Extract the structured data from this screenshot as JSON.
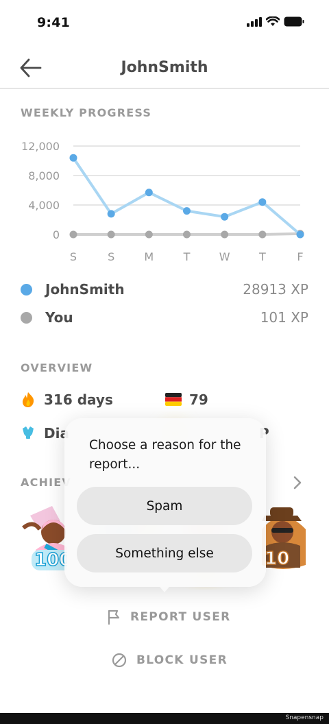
{
  "status": {
    "time": "9:41"
  },
  "header": {
    "title": "JohnSmith"
  },
  "weekly": {
    "section_title": "WEEKLY PROGRESS",
    "legend": [
      {
        "name": "JohnSmith",
        "xp": "28913 XP",
        "color": "#5aa9e6"
      },
      {
        "name": "You",
        "xp": "101 XP",
        "color": "#a8a8a8"
      }
    ]
  },
  "chart_data": {
    "type": "line",
    "categories": [
      "S",
      "S",
      "M",
      "T",
      "W",
      "T",
      "F"
    ],
    "y_ticks": [
      "12,000",
      "8,000",
      "4,000",
      "0"
    ],
    "ylim": [
      0,
      12000
    ],
    "grid": true,
    "series": [
      {
        "name": "JohnSmith",
        "values": [
          10400,
          2800,
          5700,
          3200,
          2400,
          4400,
          0
        ],
        "color": "#5aa9e6"
      },
      {
        "name": "You",
        "values": [
          0,
          0,
          0,
          0,
          0,
          0,
          101
        ],
        "color": "#a8a8a8"
      }
    ]
  },
  "overview": {
    "section_title": "OVERVIEW",
    "streak": "316 days",
    "flag_count": "79",
    "league_partial": "Dia",
    "xp_partial": "P"
  },
  "achievements": {
    "section_title_partial": "ACHIEV",
    "badge_left": "100",
    "badge_right": "10"
  },
  "popup": {
    "title": "Choose a reason for the report...",
    "options": [
      "Spam",
      "Something else"
    ]
  },
  "actions": {
    "report": "REPORT USER",
    "block": "BLOCK USER"
  },
  "watermark": "Snapensnap"
}
